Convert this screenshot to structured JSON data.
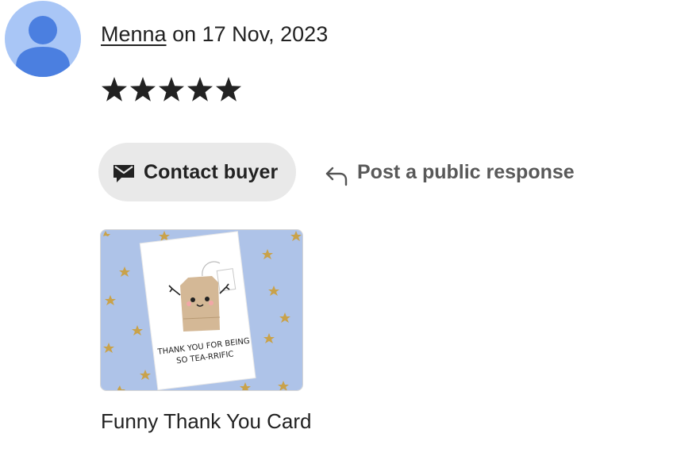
{
  "review": {
    "reviewer_name": "Menna",
    "date_text": " on 17 Nov, 2023",
    "rating": 5,
    "rating_max": 5,
    "star_color": "#222222"
  },
  "actions": {
    "contact_buyer_label": "Contact buyer",
    "contact_buyer_icon": "mail-icon",
    "public_response_label": "Post a public response",
    "public_response_icon": "reply-arrow-icon"
  },
  "product": {
    "title": "Funny Thank You Card",
    "image_text_line1": "THANK YOU FOR BEING",
    "image_text_line2": "SO TEA-RRIFIC",
    "image_background_color": "#aec3e8",
    "star_confetti_color": "#c9a24a"
  },
  "colors": {
    "avatar_background": "#a9c6f6",
    "avatar_figure": "#4b7fe0",
    "button_background": "#e9e9e9",
    "secondary_text": "#595959"
  }
}
